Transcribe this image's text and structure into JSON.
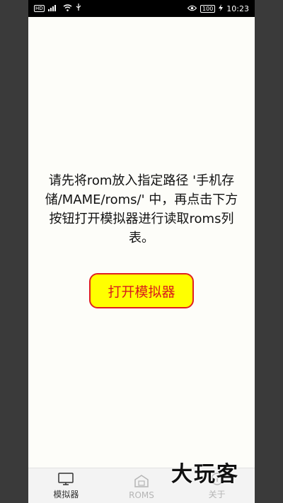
{
  "status_bar": {
    "network_icons": "HD 4G signal-icon wifi-icon usb-icon",
    "hd_label": "HD",
    "battery": "100",
    "time": "10:23"
  },
  "main": {
    "message": "请先将rom放入指定路径 '手机存储/MAME/roms/' 中，再点击下方按钮打开模拟器进行读取roms列表。",
    "open_button_label": "打开模拟器"
  },
  "bottom_nav": {
    "items": [
      {
        "label": "模拟器",
        "icon": "monitor-icon",
        "active": true
      },
      {
        "label": "ROMS",
        "icon": "rom-folder-icon",
        "active": false
      },
      {
        "label": "关于",
        "icon": "info-icon",
        "active": false
      }
    ]
  },
  "watermark": "大玩客",
  "colors": {
    "button_bg": "#ffff00",
    "button_border": "#e02020",
    "button_text": "#d91c1c",
    "page_bg": "#fdfdf9"
  }
}
